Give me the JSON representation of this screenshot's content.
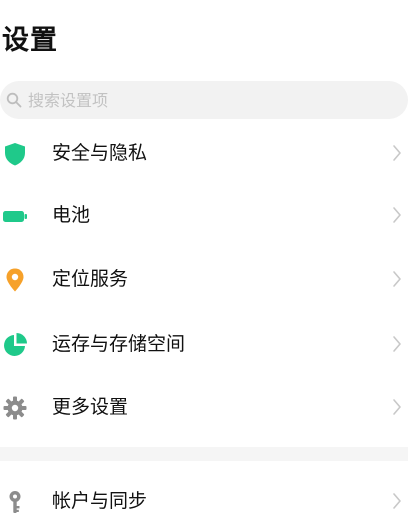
{
  "header": {
    "title": "设置"
  },
  "search": {
    "placeholder": "搜索设置项",
    "icon": "search-icon"
  },
  "items": [
    {
      "label": "安全与隐私",
      "icon": "shield-icon",
      "color": "#1fc98a"
    },
    {
      "label": "电池",
      "icon": "battery-icon",
      "color": "#1fc98a"
    },
    {
      "label": "定位服务",
      "icon": "location-pin-icon",
      "color": "#f6a12a"
    },
    {
      "label": "运存与存储空间",
      "icon": "pie-chart-icon",
      "color": "#1fc98a"
    },
    {
      "label": "更多设置",
      "icon": "gear-icon",
      "color": "#8c8c8c"
    },
    {
      "label": "帐户与同步",
      "icon": "key-icon",
      "color": "#8c8c8c"
    }
  ],
  "colors": {
    "accent_green": "#1fc98a",
    "accent_orange": "#f6a12a",
    "icon_gray": "#8c8c8c",
    "chevron_gray": "#c8c8c8"
  }
}
